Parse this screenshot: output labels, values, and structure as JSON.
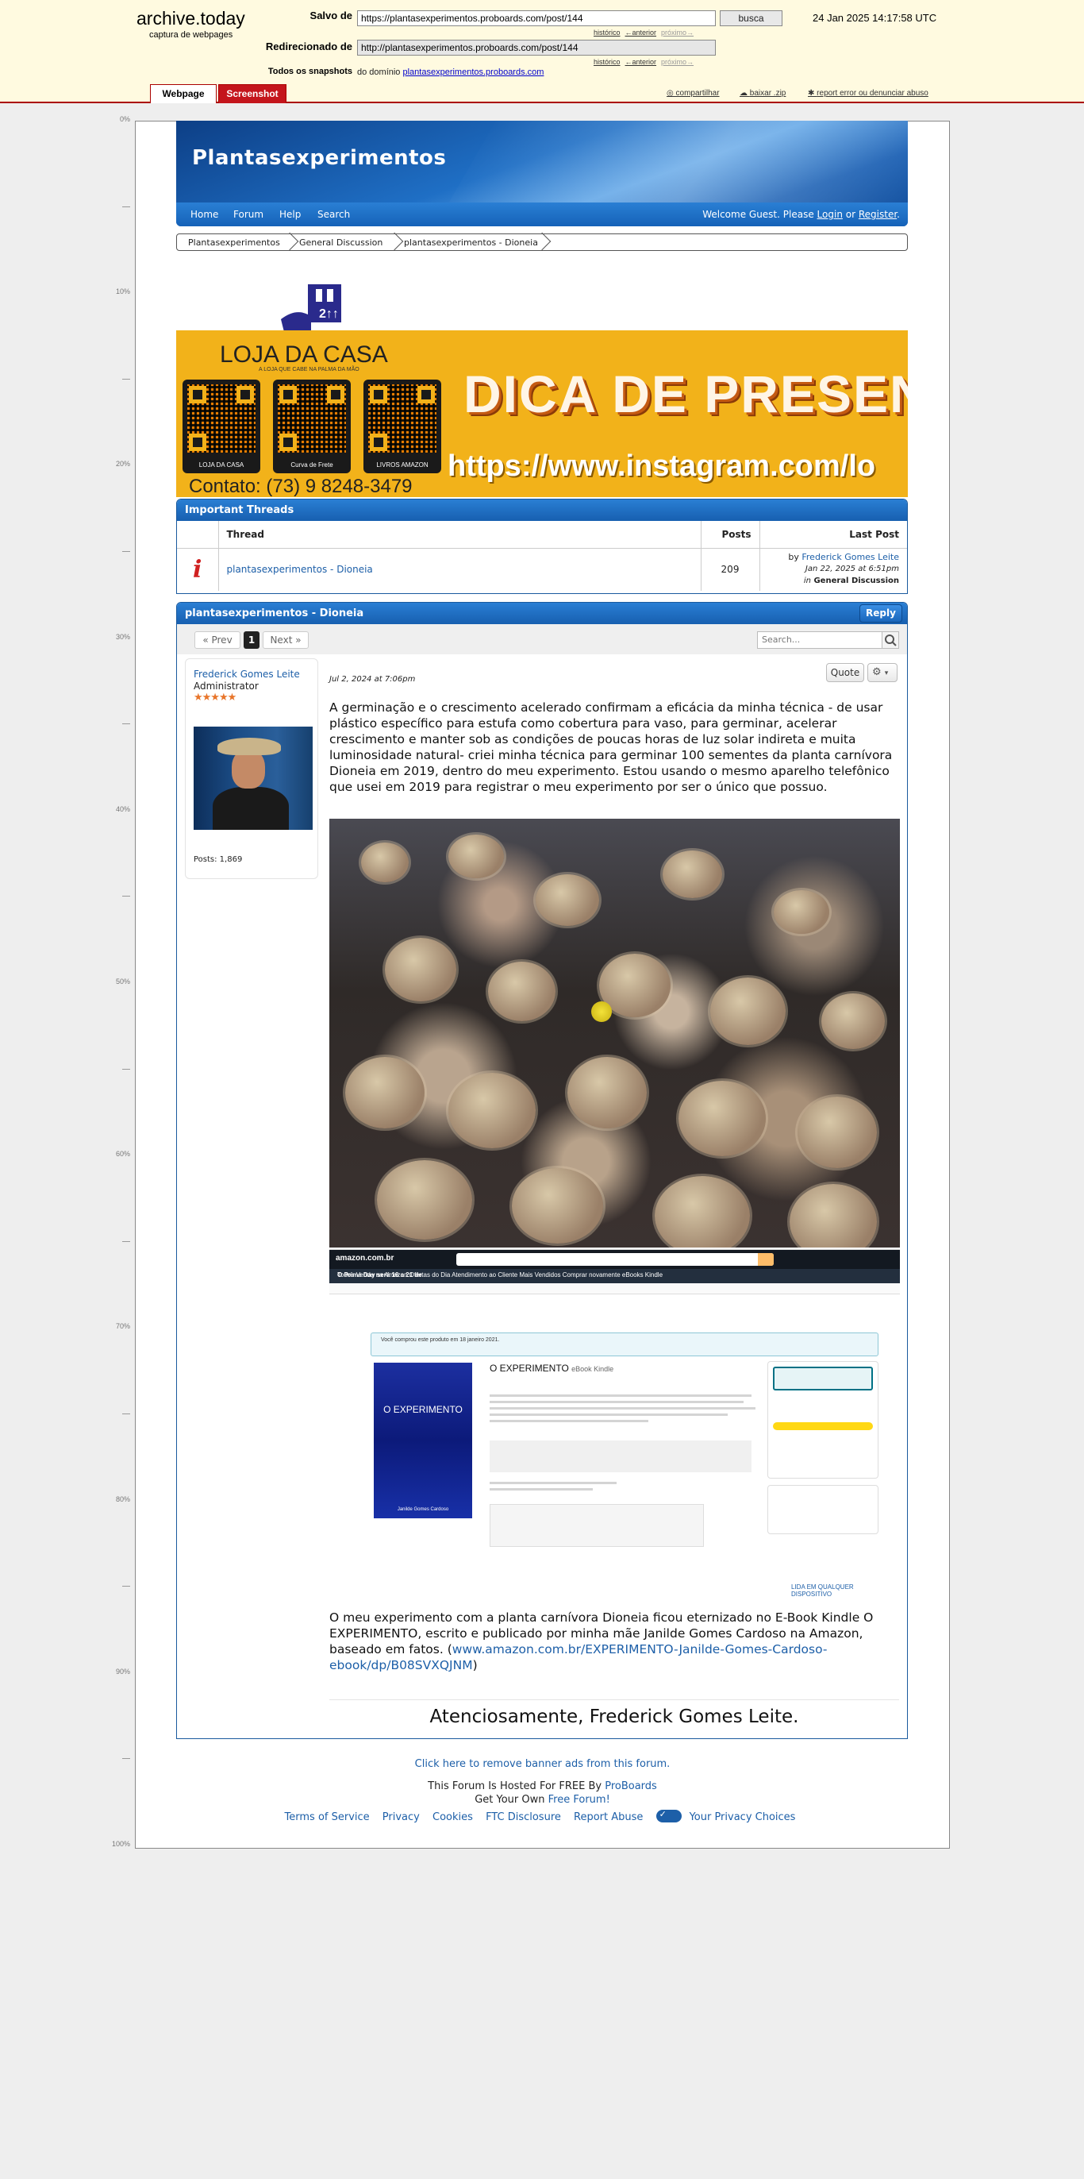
{
  "archive": {
    "title": "archive.today",
    "subtitle": "captura de webpages",
    "saved_label": "Salvo de",
    "saved_url": "https://plantasexperimentos.proboards.com/post/144",
    "search_button": "busca",
    "date": "24 Jan 2025 14:17:58 UTC",
    "redirect_label": "Redirecionado de",
    "redirect_url": "http://plantasexperimentos.proboards.com/post/144",
    "snapshots_label": "Todos os snapshots",
    "snapshots_prefix": "do domínio",
    "snapshots_domain": "plantasexperimentos.proboards.com",
    "link_history": "histórico",
    "link_prev": "←anterior",
    "link_next": "próximo→",
    "tab_webpage": "Webpage",
    "tab_screenshot": "Screenshot",
    "action_share": "compartilhar",
    "action_download": "baixar .zip",
    "action_report": "report error ou denunciar abuso"
  },
  "ruler": [
    "0%",
    "10%",
    "20%",
    "30%",
    "40%",
    "50%",
    "60%",
    "70%",
    "80%",
    "90%",
    "100%"
  ],
  "forum": {
    "title": "Plantasexperimentos",
    "nav": [
      "Home",
      "Forum",
      "Help",
      "Search"
    ],
    "welcome_prefix": "Welcome Guest. Please",
    "login": "Login",
    "or": "or",
    "register": "Register",
    "breadcrumbs": [
      "Plantasexperimentos",
      "General Discussion",
      "plantasexperimentos - Dioneia"
    ]
  },
  "banner": {
    "brand": "LOJA DA CASA",
    "slogan": "A LOJA QUE CABE NA PALMA DA MÃO",
    "qr_labels": [
      "LOJA DA CASA",
      "Curva de Frete",
      "LIVROS AMAZON"
    ],
    "headline": "DICA DE PRESENTE",
    "instagram": "https://www.instagram.com/lo",
    "contact": "Contato: (73) 9 8248-3479"
  },
  "important_threads": {
    "heading": "Important Threads",
    "columns": [
      "Thread",
      "Posts",
      "Last Post"
    ],
    "row": {
      "thread": "plantasexperimentos - Dioneia",
      "posts": "209",
      "by": "by",
      "author": "Frederick Gomes Leite",
      "date": "Jan 22, 2025 at 6:51pm",
      "in": "in",
      "board": "General Discussion"
    }
  },
  "thread": {
    "title": "plantasexperimentos - Dioneia",
    "reply": "Reply",
    "prev": "« Prev",
    "page": "1",
    "next": "Next »",
    "search_placeholder": "Search...",
    "author_name": "Frederick Gomes Leite",
    "author_role": "Administrator",
    "stars": "★★★★★",
    "author_posts": "Posts: 1,869",
    "post_date": "Jul 2, 2024 at 7:06pm",
    "quote": "Quote",
    "post_body": "A germinação e o crescimento acelerado confirmam a eficácia da minha técnica - de usar plástico específico para estufa como cobertura para vaso, para germinar, acelerar crescimento e manter sob as condições de poucas horas de luz solar indireta e muita luminosidade natural- criei minha técnica para germinar 100 sementes da planta carnívora Dioneia em 2019, dentro do meu experimento. Estou usando o mesmo aparelho telefônico que usei em 2019 para registrar o meu experimento por ser o único que possuo.",
    "amazon": {
      "logo": "amazon.com.br",
      "menu": "Todos   Venda na Amazon   Ofertas do Dia   Atendimento ao Cliente   Mais Vendidos   Comprar novamente   eBooks Kindle",
      "prime": "O Prime Day será 16 a 21 de",
      "bought": "Você comprou este produto em 18 janeiro 2021.",
      "book_title": "O EXPERIMENTO",
      "book_format": "eBook Kindle",
      "cover_title": "O EXPERIMENTO",
      "cover_author": "Janilde Gomes Cardoso",
      "badge": "LIDA EM QUALQUER DISPOSITIVO"
    },
    "post_footer": "O meu experimento com a planta carnívora Dioneia ficou eternizado no E-Book Kindle O EXPERIMENTO, escrito e publicado por minha mãe Janilde Gomes Cardoso na Amazon, baseado em fatos. (",
    "post_link": "www.amazon.com.br/EXPERIMENTO-Janilde-Gomes-Cardoso-ebook/dp/B08SVXQJNM",
    "post_close": ")",
    "signature": "Atenciosamente, Frederick Gomes Leite."
  },
  "footer": {
    "remove_ads": "Click here to remove banner ads from this forum.",
    "hosted": "This Forum Is Hosted For FREE By",
    "proboards": "ProBoards",
    "get_own": "Get Your Own",
    "free_forum": "Free Forum!",
    "links": [
      "Terms of Service",
      "Privacy",
      "Cookies",
      "FTC Disclosure",
      "Report Abuse"
    ],
    "privacy_choices": "Your Privacy Choices"
  }
}
